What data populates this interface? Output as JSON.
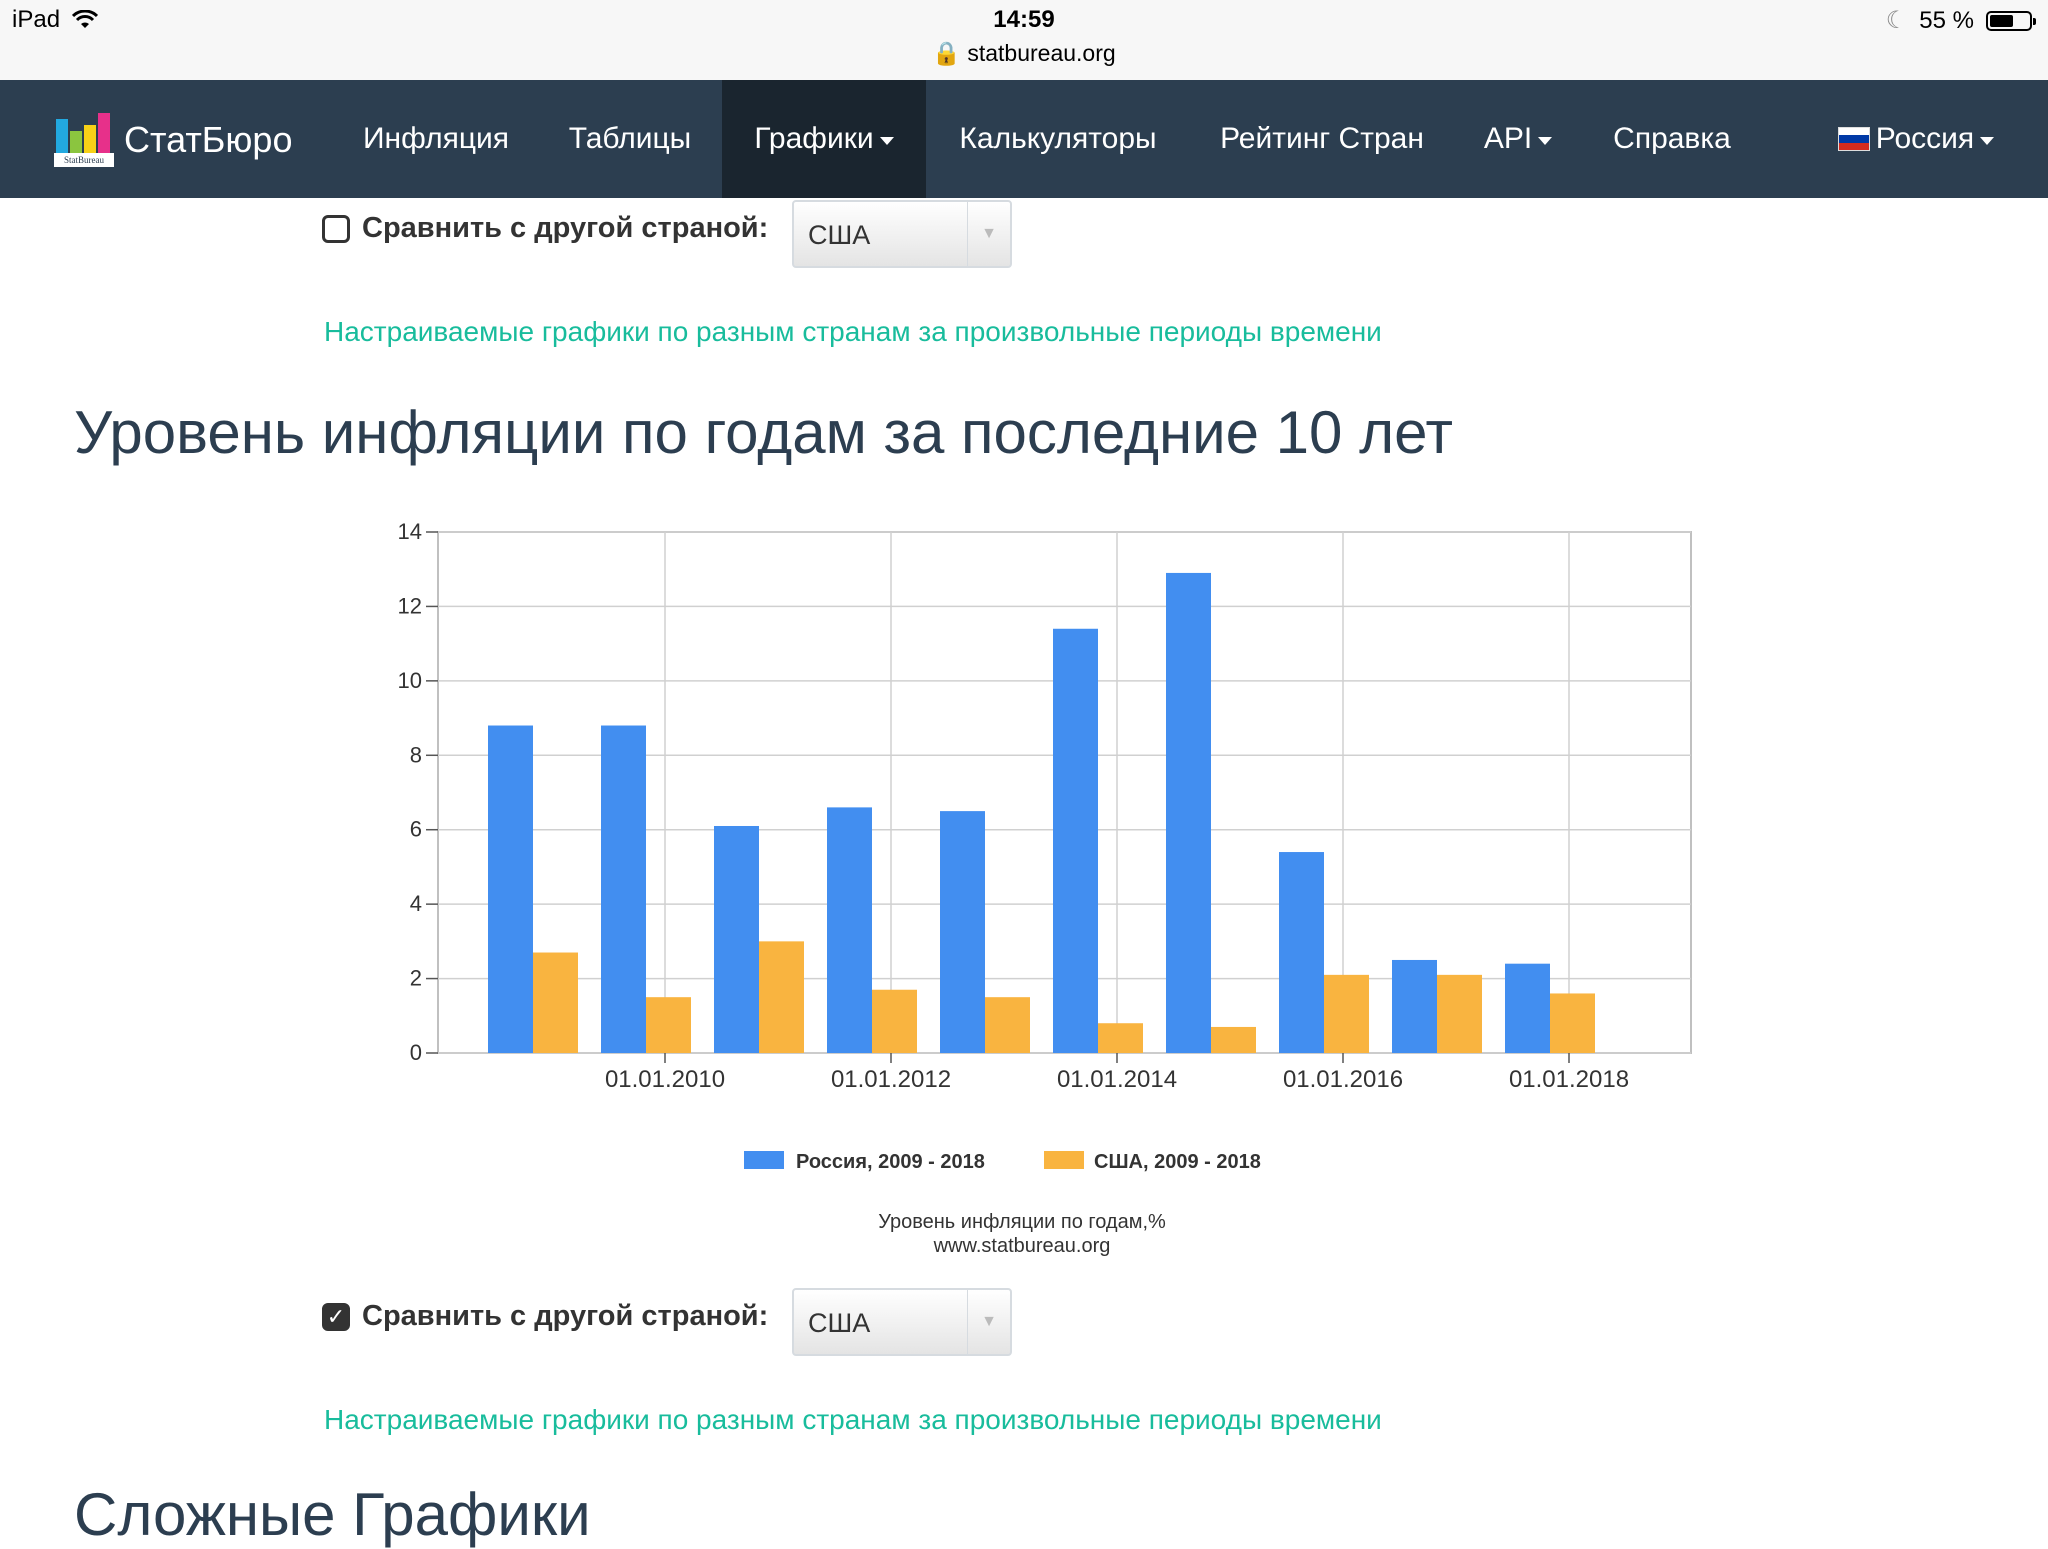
{
  "status_bar": {
    "device": "iPad",
    "time": "14:59",
    "url": "statbureau.org",
    "battery": "55 %"
  },
  "navbar": {
    "brand": "СтатБюро",
    "logo_text": "StatBureau",
    "items": [
      {
        "label": "Инфляция"
      },
      {
        "label": "Таблицы"
      },
      {
        "label": "Графики"
      },
      {
        "label": "Калькуляторы"
      },
      {
        "label": "Рейтинг Стран"
      },
      {
        "label": "API"
      },
      {
        "label": "Справка"
      },
      {
        "label": "Россия"
      }
    ]
  },
  "compare_top": {
    "label": "Сравнить с другой страной:",
    "selected": "США",
    "checked": false
  },
  "link_top": "Настраиваемые графики по разным странам за произвольные периоды времени",
  "heading_inflation": "Уровень инфляции по годам за последние 10 лет",
  "compare_bottom": {
    "label": "Сравнить с другой страной:",
    "selected": "США",
    "checked": true
  },
  "link_bottom": "Настраиваемые графики по разным странам за произвольные периоды времени",
  "heading_complex": "Сложные Графики",
  "colors": {
    "russia": "#428ef0",
    "usa": "#f9b440",
    "navbar": "#2c3e50",
    "link": "#18bc9c"
  },
  "chart_data": {
    "type": "bar",
    "categories": [
      "2009",
      "2010",
      "2011",
      "2012",
      "2013",
      "2014",
      "2015",
      "2016",
      "2017",
      "2018"
    ],
    "x_tick_labels": [
      "01.01.2010",
      "01.01.2012",
      "01.01.2014",
      "01.01.2016",
      "01.01.2018"
    ],
    "series": [
      {
        "name": "Россия, 2009 - 2018",
        "values": [
          8.8,
          8.8,
          6.1,
          6.6,
          6.5,
          11.4,
          12.9,
          5.4,
          2.5,
          2.4
        ]
      },
      {
        "name": "США, 2009 - 2018",
        "values": [
          2.7,
          1.5,
          3.0,
          1.7,
          1.5,
          0.8,
          0.7,
          2.1,
          2.1,
          1.6
        ]
      }
    ],
    "ylim": [
      0,
      14
    ],
    "y_ticks": [
      0,
      2,
      4,
      6,
      8,
      10,
      12,
      14
    ],
    "caption": "Уровень инфляции по годам,%",
    "source": "www.statbureau.org",
    "grid": true,
    "legend_position": "bottom"
  }
}
